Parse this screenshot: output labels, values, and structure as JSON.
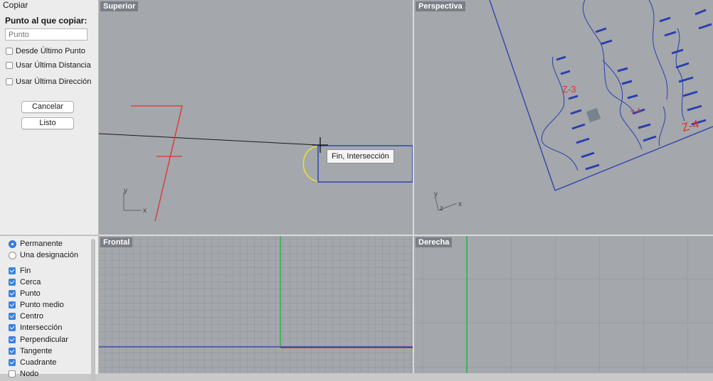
{
  "command_panel": {
    "title": "Copiar",
    "prompt": "Punto al que copiar:",
    "point_placeholder": "Punto",
    "options": [
      "Desde Último Punto",
      "Usar Última Distancia",
      "Usar Última Dirección"
    ],
    "cancel_label": "Cancelar",
    "done_label": "Listo"
  },
  "osnap": {
    "radios": [
      {
        "label": "Permanente",
        "selected": true
      },
      {
        "label": "Una designación",
        "selected": false
      }
    ],
    "snaps": [
      {
        "label": "Fin",
        "checked": true
      },
      {
        "label": "Cerca",
        "checked": true
      },
      {
        "label": "Punto",
        "checked": true
      },
      {
        "label": "Punto medio",
        "checked": true
      },
      {
        "label": "Centro",
        "checked": true
      },
      {
        "label": "Intersección",
        "checked": true
      },
      {
        "label": "Perpendicular",
        "checked": true
      },
      {
        "label": "Tangente",
        "checked": true
      },
      {
        "label": "Cuadrante",
        "checked": true
      },
      {
        "label": "Nodo",
        "checked": false
      }
    ]
  },
  "viewports": {
    "top": {
      "label": "Superior",
      "axis_x": "x",
      "axis_y": "y"
    },
    "perspective": {
      "label": "Perspectiva",
      "axis_x": "x",
      "axis_y": "y",
      "axis_z": "z"
    },
    "front": {
      "label": "Frontal"
    },
    "right": {
      "label": "Derecha"
    }
  },
  "tooltip": "Fin, Intersección",
  "drawing": {
    "labels": [
      "Z-3",
      "Y-4",
      "Z-4"
    ]
  },
  "colors": {
    "curve_blue": "#2a3fb0",
    "sketch_red": "#e0322e",
    "selection_yellow": "#e8e03a",
    "axis_green": "#2bb34a",
    "checkbox_blue": "#3b82e0"
  }
}
